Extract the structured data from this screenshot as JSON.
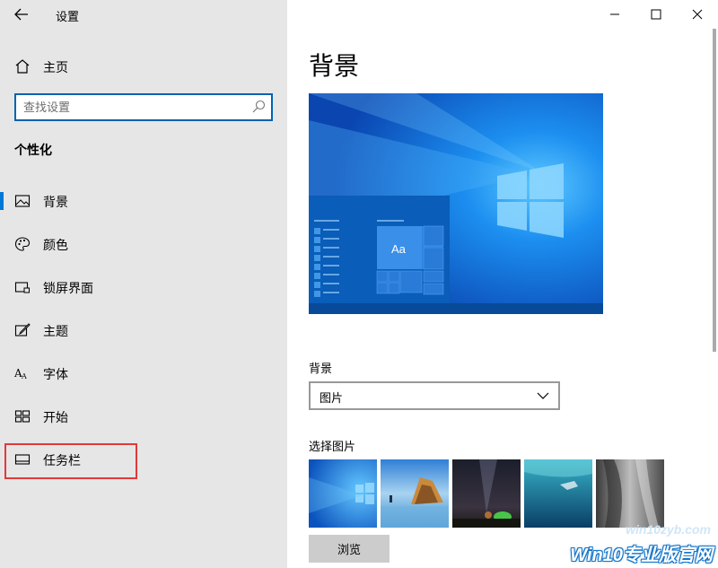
{
  "app": {
    "title": "设置"
  },
  "sidebar": {
    "home_label": "主页",
    "search_placeholder": "查找设置",
    "section_title": "个性化",
    "items": [
      {
        "label": "背景",
        "icon": "picture-icon",
        "selected": true
      },
      {
        "label": "颜色",
        "icon": "palette-icon",
        "selected": false
      },
      {
        "label": "锁屏界面",
        "icon": "lock-screen-icon",
        "selected": false
      },
      {
        "label": "主题",
        "icon": "theme-brush-icon",
        "selected": false
      },
      {
        "label": "字体",
        "icon": "font-icon",
        "selected": false
      },
      {
        "label": "开始",
        "icon": "start-grid-icon",
        "selected": false
      },
      {
        "label": "任务栏",
        "icon": "taskbar-icon",
        "selected": false
      }
    ]
  },
  "main": {
    "heading": "背景",
    "preview_tile_text": "Aa",
    "background_label": "背景",
    "background_value": "图片",
    "choose_picture_label": "选择图片",
    "browse_label": "浏览"
  },
  "watermark": {
    "url": "win10zyb.com",
    "text": "Win10专业版官网"
  },
  "colors": {
    "accent": "#0078d7",
    "sidebar_bg": "#e6e6e6",
    "highlight": "#e03a3a"
  }
}
